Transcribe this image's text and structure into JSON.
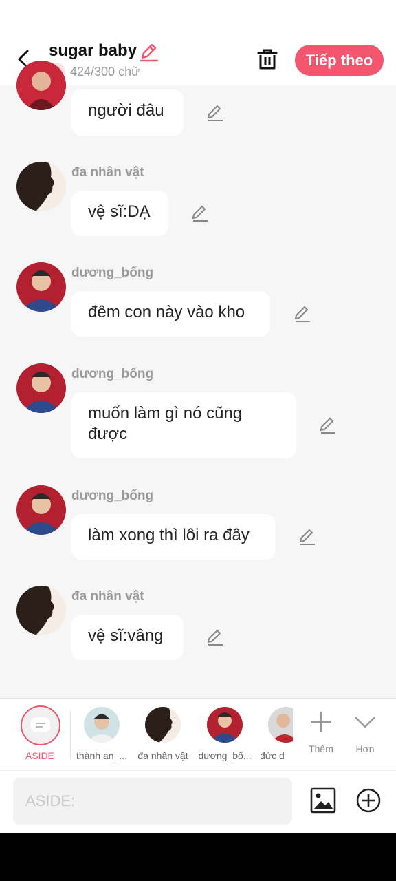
{
  "header": {
    "title": "sugar baby",
    "word_count": "424/300 chữ",
    "next_label": "Tiếp theo",
    "accent": "#f4556e"
  },
  "messages": [
    {
      "sender": "",
      "text": "người đâu",
      "avatar": "person-red"
    },
    {
      "sender": "đa nhân vật",
      "text": "vệ sĩ:DẠ",
      "avatar": "silhouette"
    },
    {
      "sender": "dương_bống",
      "text": "đêm con này vào kho",
      "avatar": "person-blue"
    },
    {
      "sender": "dương_bống",
      "text": "muốn làm gì nó cũng được",
      "avatar": "person-blue"
    },
    {
      "sender": "dương_bống",
      "text": "làm xong thì lôi ra đây",
      "avatar": "person-blue"
    },
    {
      "sender": "đa nhân vật",
      "text": "vệ sĩ:vâng",
      "avatar": "silhouette"
    }
  ],
  "characters": {
    "aside_label": "ASIDE",
    "items": [
      {
        "label": "thành an_...",
        "avatar": "person-light"
      },
      {
        "label": "đa nhân vật",
        "avatar": "silhouette"
      },
      {
        "label": "dương_bố...",
        "avatar": "person-blue"
      },
      {
        "label": "đức d",
        "avatar": "person-red"
      }
    ],
    "add_label": "Thêm",
    "more_label": "Hơn"
  },
  "composer": {
    "placeholder": "ASIDE:",
    "value": ""
  }
}
